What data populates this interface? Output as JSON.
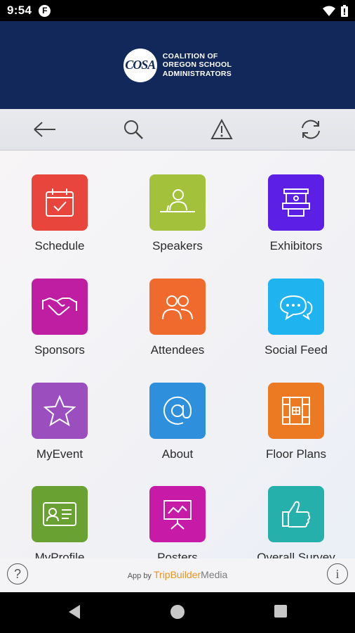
{
  "status": {
    "time": "9:54",
    "notification": "F"
  },
  "header": {
    "logo_mark": "COSA",
    "org_lines": [
      "COALITION OF",
      "OREGON SCHOOL",
      "ADMINISTRATORS"
    ]
  },
  "toolbar": {
    "icons": [
      "back-arrow-icon",
      "search-icon",
      "alert-icon",
      "refresh-icon"
    ]
  },
  "tiles": [
    {
      "label": "Schedule",
      "color": "#e8453c",
      "icon": "calendar-check-icon"
    },
    {
      "label": "Speakers",
      "color": "#a3c13a",
      "icon": "speaker-podium-icon"
    },
    {
      "label": "Exhibitors",
      "color": "#5b1fe6",
      "icon": "booth-icon"
    },
    {
      "label": "Sponsors",
      "color": "#bf1ea3",
      "icon": "handshake-icon"
    },
    {
      "label": "Attendees",
      "color": "#ef6a2c",
      "icon": "people-icon"
    },
    {
      "label": "Social Feed",
      "color": "#1fb4f0",
      "icon": "chat-bubbles-icon"
    },
    {
      "label": "MyEvent",
      "color": "#9b4fbf",
      "icon": "star-icon"
    },
    {
      "label": "About",
      "color": "#2e8fdc",
      "icon": "at-sign-icon"
    },
    {
      "label": "Floor Plans",
      "color": "#ec7a22",
      "icon": "floor-plan-icon"
    },
    {
      "label": "MyProfile",
      "color": "#69a132",
      "icon": "id-card-icon"
    },
    {
      "label": "Posters",
      "color": "#c61aa7",
      "icon": "presentation-icon"
    },
    {
      "label": "Overall Survey",
      "color": "#26b0ac",
      "icon": "thumbs-up-icon"
    }
  ],
  "footer": {
    "app_by": "App by",
    "brand_a": "TripBuilder",
    "brand_b": "Media",
    "help": "?",
    "info": "i"
  },
  "colors": {
    "header": "#13285a",
    "statusbar": "#000000"
  }
}
